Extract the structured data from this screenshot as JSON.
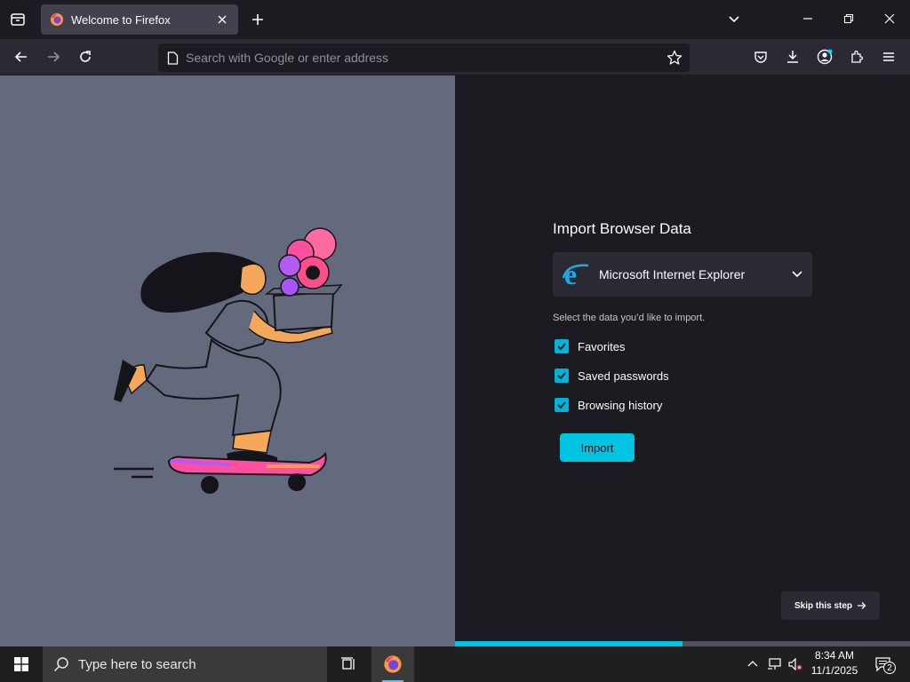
{
  "tabs": [
    {
      "label": "Welcome to Firefox"
    }
  ],
  "urlbar": {
    "placeholder": "Search with Google or enter address"
  },
  "import": {
    "title": "Import Browser Data",
    "browser": "Microsoft Internet Explorer",
    "instructions": "Select the data you’d like to import.",
    "options": [
      {
        "label": "Favorites",
        "checked": true
      },
      {
        "label": "Saved passwords",
        "checked": true
      },
      {
        "label": "Browsing history",
        "checked": true
      }
    ],
    "import_label": "Import",
    "skip_label": "Skip this step"
  },
  "progress": {
    "fraction": 0.5
  },
  "taskbar": {
    "search_placeholder": "Type here to search",
    "time": "8:34 AM",
    "date": "11/1/2025",
    "notification_count": "2"
  },
  "colors": {
    "accent": "#00c4e1",
    "illustration_bg": "#636a7d",
    "dark_bg": "#1c1b22"
  },
  "icons": [
    "firefox-view-icon",
    "firefox-logo-icon",
    "close-icon",
    "plus-icon",
    "chevron-down-icon",
    "minimize-icon",
    "restore-icon",
    "window-close-icon",
    "back-arrow-icon",
    "forward-arrow-icon",
    "reload-icon",
    "page-icon",
    "star-icon",
    "pocket-icon",
    "download-icon",
    "account-icon",
    "extensions-icon",
    "hamburger-menu-icon",
    "ie-logo-icon",
    "checkmark-icon",
    "arrow-right-icon",
    "windows-start-icon",
    "search-icon",
    "task-view-icon",
    "chevron-up-icon",
    "network-icon",
    "volume-muted-icon",
    "notification-icon"
  ]
}
